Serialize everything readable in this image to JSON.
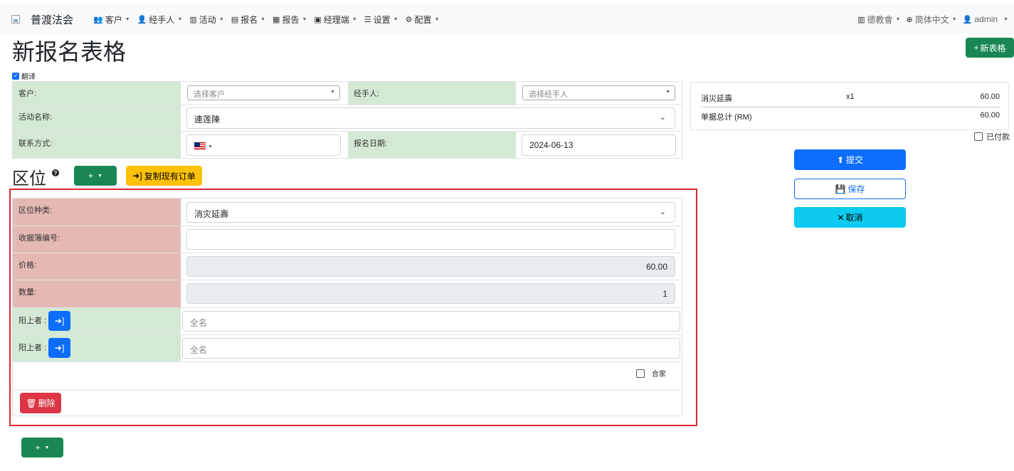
{
  "navbar": {
    "brand": "普渡法会",
    "menu": [
      {
        "icon": "users-icon",
        "glyph": "👥",
        "label": "客户"
      },
      {
        "icon": "user-tie-icon",
        "glyph": "👤",
        "label": "经手人"
      },
      {
        "icon": "map-icon",
        "glyph": "▥",
        "label": "活动"
      },
      {
        "icon": "clipboard-icon",
        "glyph": "▤",
        "label": "报名"
      },
      {
        "icon": "file-report-icon",
        "glyph": "▦",
        "label": "报告"
      },
      {
        "icon": "briefcase-icon",
        "glyph": "▣",
        "label": "经理端"
      },
      {
        "icon": "sliders-icon",
        "glyph": "☰",
        "label": "设置"
      },
      {
        "icon": "gear-icon",
        "glyph": "⚙",
        "label": "配置"
      }
    ],
    "right": [
      {
        "icon": "building-icon",
        "glyph": "▥",
        "label": "德教會"
      },
      {
        "icon": "globe-icon",
        "glyph": "⊕",
        "label": "简体中文"
      },
      {
        "icon": "user-icon",
        "glyph": "👤",
        "label": "admin"
      }
    ]
  },
  "page": {
    "title": "新报名表格",
    "new_form_button": "新表格",
    "translate_label": "翻译"
  },
  "main_form": {
    "customer_label": "客户:",
    "customer_placeholder": "选择客户",
    "handler_label": "经手人:",
    "handler_placeholder": "选择经手人",
    "event_label": "活动名称:",
    "event_value": "連莲陳",
    "contact_label": "联系方式:",
    "date_label": "报名日期:",
    "date_value": "2024-06-13"
  },
  "section": {
    "title": "区位",
    "copy_order_button": "复制现有订单"
  },
  "slot": {
    "type_label": "区位种类:",
    "type_value": "消灾延壽",
    "receipt_label": "收据簿编号:",
    "receipt_value": "",
    "price_label": "价格:",
    "price_value": "60.00",
    "qty_label": "数量:",
    "qty_value": "1",
    "beneficiaries": [
      {
        "label": "阳上者 :",
        "placeholder": "全名"
      },
      {
        "label": "阳上者 :",
        "placeholder": "全名"
      }
    ],
    "family_label": "合家",
    "delete_button": "删除"
  },
  "summary": {
    "items": [
      {
        "name": "消災延壽",
        "qty": "x1",
        "amount": "60.00"
      }
    ],
    "total_label": "单据总计 (RM)",
    "total_value": "60.00",
    "paid_label": "已付款"
  },
  "actions": {
    "submit": "提交",
    "save": "保存",
    "cancel": "取消"
  },
  "colors": {
    "primary": "#0d6efd",
    "success": "#198754",
    "warning": "#ffc107",
    "danger": "#dc3545",
    "info": "#0dcaf0",
    "label_green": "#d4e9d4",
    "label_red": "#e5b9b3",
    "highlight_frame": "#dc2836"
  }
}
